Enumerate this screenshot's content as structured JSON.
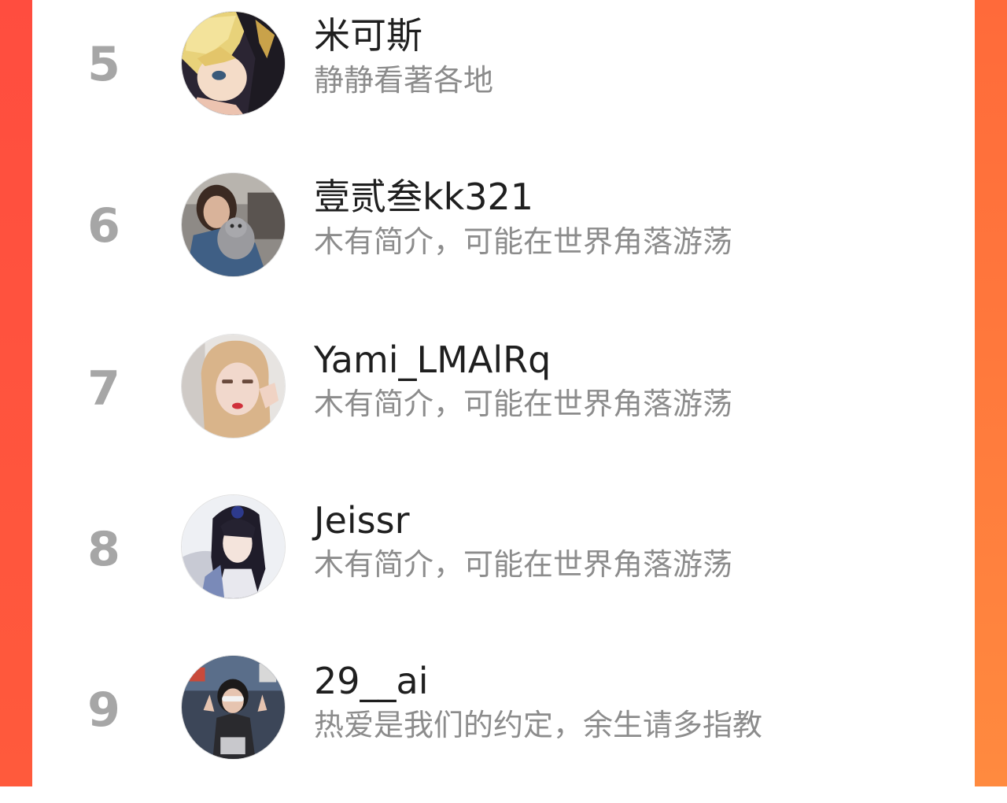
{
  "colors": {
    "accent_left": "#ff4d3f",
    "accent_right": "#ff8a3f",
    "rank_gray": "#a6a6a6",
    "name_text": "#1f1f1f",
    "bio_text": "#8c8c8c"
  },
  "ranking": {
    "items": [
      {
        "rank": "5",
        "name": "米可斯",
        "bio": "静静看著各地",
        "avatar_icon": "anime-blond-boy-avatar-icon"
      },
      {
        "rank": "6",
        "name": "壹贰叁kk321",
        "bio": "木有简介，可能在世界角落游荡",
        "avatar_icon": "woman-holding-cat-avatar-icon"
      },
      {
        "rank": "7",
        "name": "Yami_LMAlRq",
        "bio": "木有简介，可能在世界角落游荡",
        "avatar_icon": "blonde-girl-selfie-avatar-icon"
      },
      {
        "rank": "8",
        "name": "Jeissr",
        "bio": "木有简介，可能在世界角落游荡",
        "avatar_icon": "anime-dark-hair-man-avatar-icon"
      },
      {
        "rank": "9",
        "name": "29__ai",
        "bio": "热爱是我们的约定，余生请多指教",
        "avatar_icon": "girl-sunglasses-peace-sign-avatar-icon"
      }
    ]
  }
}
